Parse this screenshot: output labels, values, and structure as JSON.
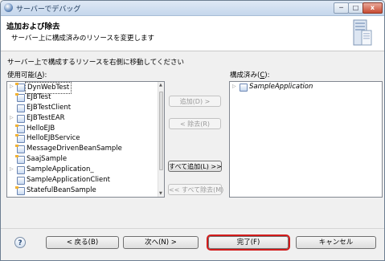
{
  "window": {
    "title": "サーバーでデバッグ",
    "min": "─",
    "max": "□",
    "close": "x"
  },
  "header": {
    "title": "追加および除去",
    "subtitle": "サーバー上に構成済みのリソースを変更します"
  },
  "intro": "サーバー上で構成するリソースを右側に移動してください",
  "available": {
    "label": "使用可能(",
    "mnemonic": "A",
    "label_end": "):",
    "items": [
      {
        "name": "DynWebTest",
        "expand": "▷",
        "icon": "project-icon",
        "selected": true
      },
      {
        "name": "EJBTest",
        "expand": "",
        "icon": "project-icon"
      },
      {
        "name": "EJBTestClient",
        "expand": "",
        "icon": "jar-icon"
      },
      {
        "name": "EJBTestEAR",
        "expand": "▷",
        "icon": "ear-icon"
      },
      {
        "name": "HelloEJB",
        "expand": "",
        "icon": "project-icon"
      },
      {
        "name": "HelloEJBService",
        "expand": "",
        "icon": "project-icon"
      },
      {
        "name": "MessageDrivenBeanSample",
        "expand": "",
        "icon": "project-icon"
      },
      {
        "name": "SaajSample",
        "expand": "",
        "icon": "project-icon"
      },
      {
        "name": "SampleApplication_",
        "expand": "▷",
        "icon": "ear-icon"
      },
      {
        "name": "SampleApplicationClient",
        "expand": "",
        "icon": "jar-icon"
      },
      {
        "name": "StatefulBeanSample",
        "expand": "",
        "icon": "project-icon"
      }
    ]
  },
  "configured": {
    "label": "構成済み(",
    "mnemonic": "C",
    "label_end": "):",
    "items": [
      {
        "name": "SampleApplication",
        "expand": "▷",
        "icon": "ear-icon"
      }
    ]
  },
  "buttons": {
    "add": "追加(D) >",
    "remove": "< 除去(R)",
    "add_all": "すべて追加(L) >>",
    "remove_all": "<< すべて除去(M)",
    "back": "< 戻る(B)",
    "next": "次へ(N) >",
    "finish": "完了(F)",
    "cancel": "キャンセル",
    "help": "?"
  },
  "colors": {
    "finish_highlight": "#d21b1b"
  }
}
